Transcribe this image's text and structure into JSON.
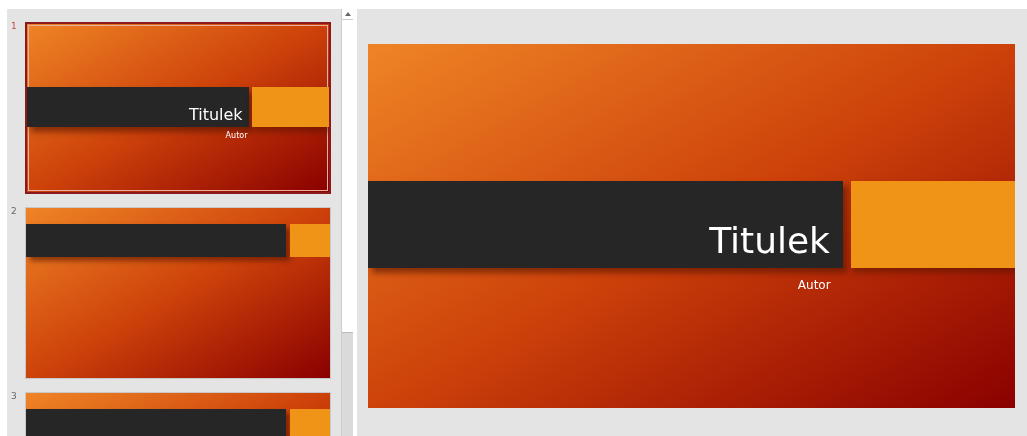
{
  "thumbnails": [
    {
      "number": "1",
      "selected": true,
      "kind": "title",
      "title": "Titulek",
      "subtitle": "Autor"
    },
    {
      "number": "2",
      "selected": false,
      "kind": "header"
    },
    {
      "number": "3",
      "selected": false,
      "kind": "header"
    }
  ],
  "editor": {
    "kind": "title",
    "title": "Titulek",
    "subtitle": "Autor"
  }
}
